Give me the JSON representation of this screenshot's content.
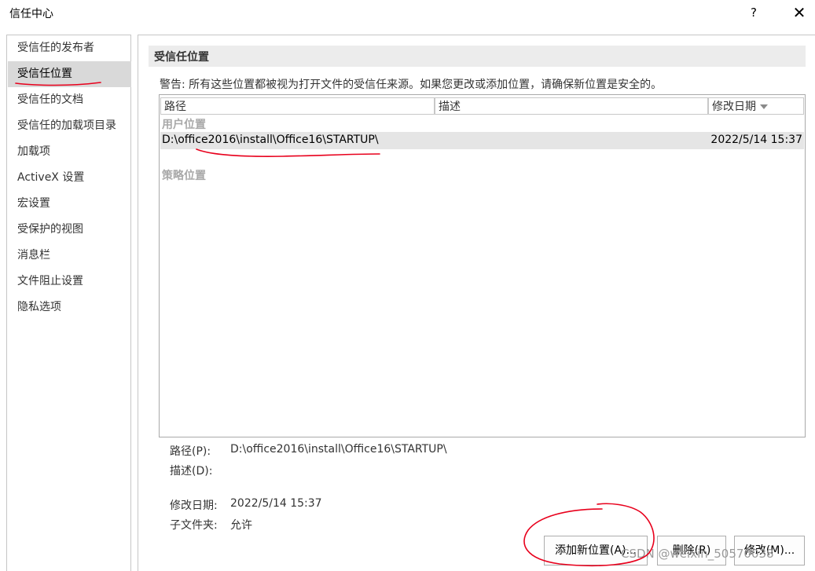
{
  "window": {
    "title": "信任中心",
    "help_glyph": "?",
    "close_glyph": "✕"
  },
  "sidebar": {
    "items": [
      {
        "label": "受信任的发布者",
        "selected": false
      },
      {
        "label": "受信任位置",
        "selected": true
      },
      {
        "label": "受信任的文档",
        "selected": false
      },
      {
        "label": "受信任的加载项目录",
        "selected": false
      },
      {
        "label": "加载项",
        "selected": false
      },
      {
        "label": "ActiveX 设置",
        "selected": false
      },
      {
        "label": "宏设置",
        "selected": false
      },
      {
        "label": "受保护的视图",
        "selected": false
      },
      {
        "label": "消息栏",
        "selected": false
      },
      {
        "label": "文件阻止设置",
        "selected": false
      },
      {
        "label": "隐私选项",
        "selected": false
      }
    ]
  },
  "main": {
    "section_title": "受信任位置",
    "warning": "警告: 所有这些位置都被视为打开文件的受信任来源。如果您更改或添加位置，请确保新位置是安全的。",
    "list": {
      "columns": {
        "path": "路径",
        "description": "描述",
        "modified": "修改日期"
      },
      "user_group": "用户位置",
      "rows": [
        {
          "path": "D:\\office2016\\install\\Office16\\STARTUP\\",
          "description": "",
          "modified": "2022/5/14 15:37"
        }
      ],
      "policy_group": "策略位置"
    },
    "details": {
      "path_label": "路径(P):",
      "path_value": "D:\\office2016\\install\\Office16\\STARTUP\\",
      "description_label": "描述(D):",
      "modified_label": "修改日期:",
      "modified_value": "2022/5/14 15:37",
      "subfolders_label": "子文件夹:",
      "subfolders_value": "允许"
    },
    "buttons": {
      "add": "添加新位置(A)...",
      "remove": "删除(R)",
      "modify": "修改(M)..."
    }
  },
  "watermark": "CSDN @weixin_50570038",
  "colors": {
    "annotation": "#e8001c",
    "selection": "#d9d9d9",
    "row_highlight": "#e5e5e5"
  }
}
